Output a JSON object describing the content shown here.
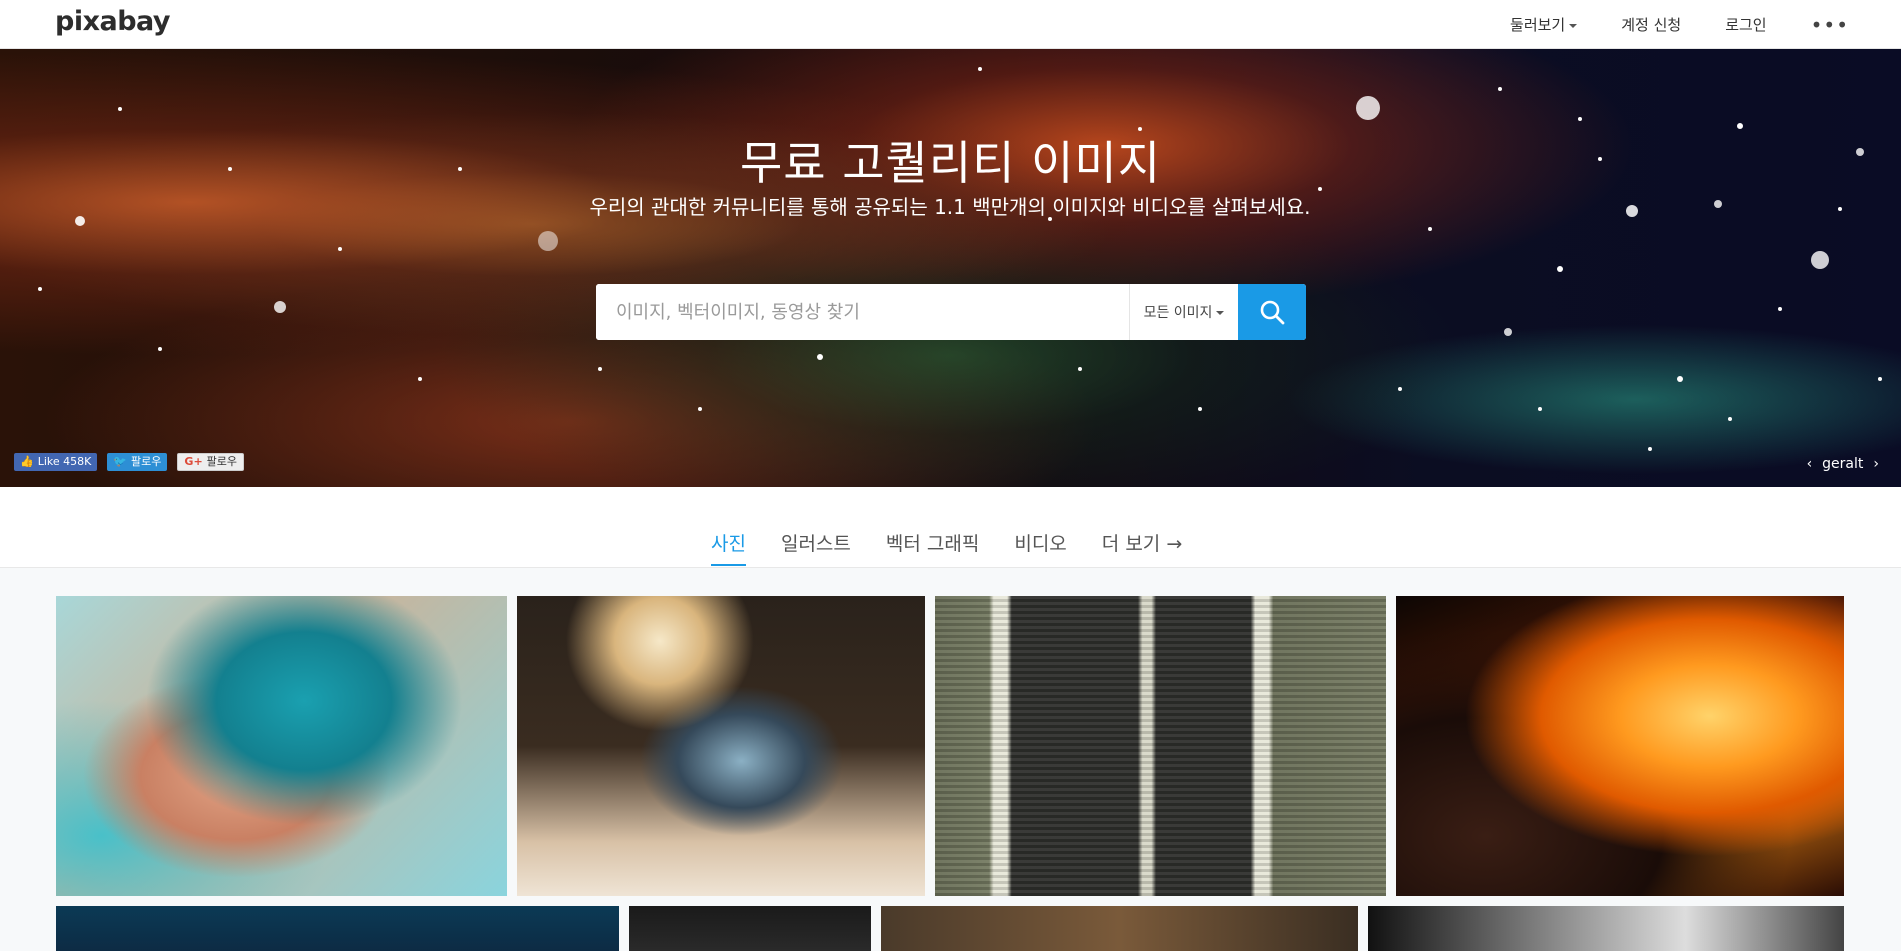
{
  "nav": {
    "logo": "pixabay",
    "explore": "둘러보기",
    "signup": "계정 신청",
    "login": "로그인",
    "more": "•••"
  },
  "hero": {
    "title": "무료 고퀄리티 이미지",
    "subtitle": "우리의 관대한 커뮤니티를 통해 공유되는 1.1 백만개의 이미지와 비디오를 살펴보세요.",
    "search_placeholder": "이미지, 벡터이미지, 동영상 찾기",
    "search_type": "모든 이미지",
    "credit": "geralt",
    "credit_prev": "‹",
    "credit_next": "›"
  },
  "social": {
    "facebook": "Like 458K",
    "twitter": "팔로우",
    "google": "팔로우"
  },
  "tabs": [
    {
      "label": "사진"
    },
    {
      "label": "일러스트"
    },
    {
      "label": "벡터 그래픽"
    },
    {
      "label": "비디오"
    },
    {
      "label": "더 보기 →"
    }
  ],
  "colors": {
    "accent": "#1a9ae6"
  }
}
